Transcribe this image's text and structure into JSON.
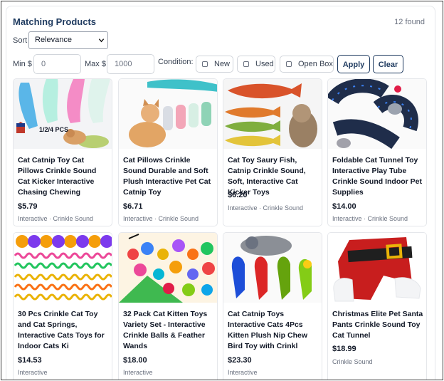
{
  "header": {
    "title": "Matching Products",
    "count": "12 found"
  },
  "sort": {
    "label": "Sort",
    "selected": "Relevance"
  },
  "filters": {
    "min_label": "Min $",
    "min_placeholder": "0",
    "max_label": "Max $",
    "max_placeholder": "1000",
    "condition_label": "Condition:",
    "conditions": [
      "New",
      "Used",
      "Open Box"
    ],
    "apply_label": "Apply",
    "clear_label": "Clear"
  },
  "products": [
    {
      "name": "Cat Catnip Toy Cat Pillows Crinkle Sound Cat Kicker Interactive Chasing Chewing",
      "price": "$5.79",
      "tags": "Interactive · Crinkle Sound",
      "image_badge": "1/2/4 PCS"
    },
    {
      "name": "Cat Pillows Crinkle Sound Durable and Soft Plush Interactive Pet Cat Catnip Toy",
      "price": "$6.71",
      "tags": "Interactive · Crinkle Sound"
    },
    {
      "name": "Cat Toy Saury Fish, Catnip Crinkle Sound, Soft, Interactive Cat Kicker Toys",
      "price": "$6.20",
      "tags": "Interactive · Crinkle Sound"
    },
    {
      "name": "Foldable Cat Tunnel Toy Interactive Play Tube Crinkle Sound Indoor Pet Supplies",
      "price": "$14.00",
      "tags": "Interactive · Crinkle Sound"
    },
    {
      "name": "30 Pcs Crinkle Cat Toy and Cat Springs, Interactive Cats Toys for Indoor Cats Ki",
      "price": "$14.53",
      "tags": "Interactive"
    },
    {
      "name": "32 Pack Cat Kitten Toys Variety Set - Interactive Crinkle Balls & Feather Wands",
      "price": "$18.00",
      "tags": "Interactive"
    },
    {
      "name": "Cat Catnip Toys Interactive Cats 4Pcs Kitten Plush Nip Chew Bird Toy with Crinkl",
      "price": "$23.30",
      "tags": "Interactive"
    },
    {
      "name": "Christmas Elite Pet Santa Pants Crinkle Sound Toy Cat Tunnel",
      "price": "$18.99",
      "tags": "Crinkle Sound"
    }
  ],
  "colors": {
    "accent": "#1e3a5f",
    "muted": "#6b7280",
    "border": "#e5e7eb"
  }
}
